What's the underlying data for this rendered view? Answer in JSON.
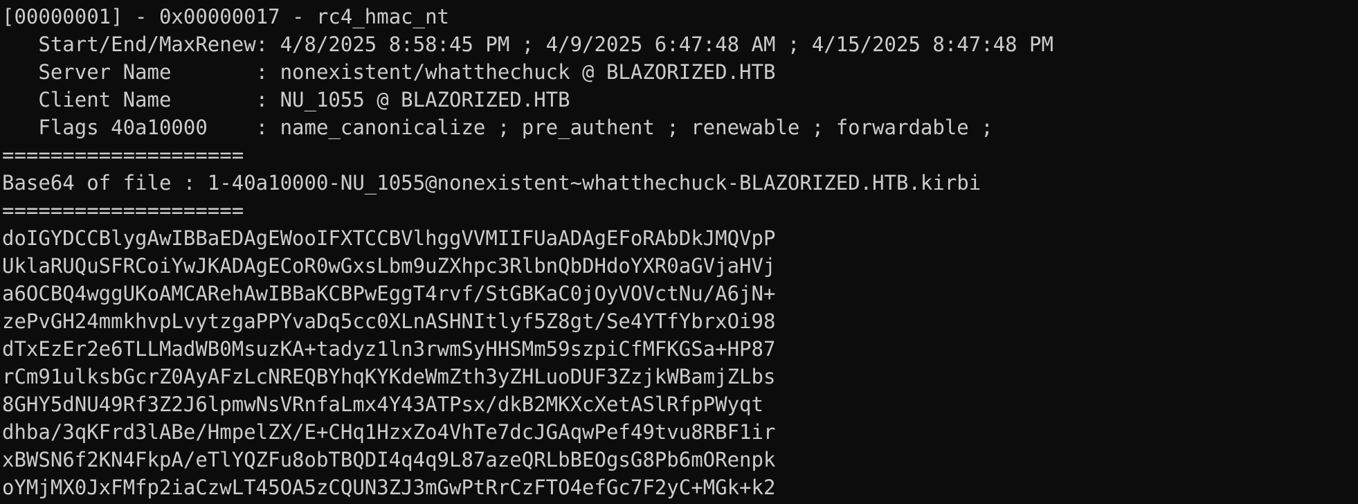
{
  "terminal": {
    "ticket_header": "[00000001] - 0x00000017 - rc4_hmac_nt",
    "start_end": "   Start/End/MaxRenew: 4/8/2025 8:58:45 PM ; 4/9/2025 6:47:48 AM ; 4/15/2025 8:47:48 PM",
    "server_name": "   Server Name       : nonexistent/whatthechuck @ BLAZORIZED.HTB",
    "client_name": "   Client Name       : NU_1055 @ BLAZORIZED.HTB",
    "flags": "   Flags 40a10000    : name_canonicalize ; pre_authent ; renewable ; forwardable ;",
    "separator_1": "====================",
    "base64_label": "Base64 of file : 1-40a10000-NU_1055@nonexistent~whatthechuck-BLAZORIZED.HTB.kirbi",
    "separator_2": "====================",
    "base64_lines": [
      "doIGYDCCBlygAwIBBaEDAgEWooIFXTCCBVlhggVVMIIFUaADAgEFoRAbDkJMQVpP",
      "UklaRUQuSFRCoiYwJKADAgECoR0wGxsLbm9uZXhpc3RlbnQbDHdoYXR0aGVjaHVj",
      "a6OCBQ4wggUKoAMCARehAwIBBaKCBPwEggT4rvf/StGBKaC0jOyVOVctNu/A6jN+",
      "zePvGH24mmkhvpLvytzgaPPYvaDq5cc0XLnASHNItlyf5Z8gt/Se4YTfYbrxOi98",
      "dTxEzEr2e6TLLMadWB0MsuzKA+tadyz1ln3rwmSyHHSMm59szpiCfMFKGSa+HP87",
      "rCm91ulksbGcrZ0AyAFzLcNREQBYhqKYKdeWmZth3yZHLuoDUF3ZzjkWBamjZLbs",
      "8GHY5dNU49Rf3Z2J6lpmwNsVRnfaLmx4Y43ATPsx/dkB2MKXcXetASlRfpPWyqt",
      "dhba/3qKFrd3lABe/HmpelZX/E+CHq1HzxZo4VhTe7dcJGAqwPef49tvu8RBF1ir",
      "xBWSN6f2KN4FkpA/eTlYQZFu8obTBQDI4q4q9L87azeQRLbBEOgsG8Pb6mORenpk",
      "oYMjMX0JxFMfp2iaCzwLT45OA5zCQUN3ZJ3mGwPtRrCzFTO4efGc7F2yC+MGk+k2"
    ]
  }
}
